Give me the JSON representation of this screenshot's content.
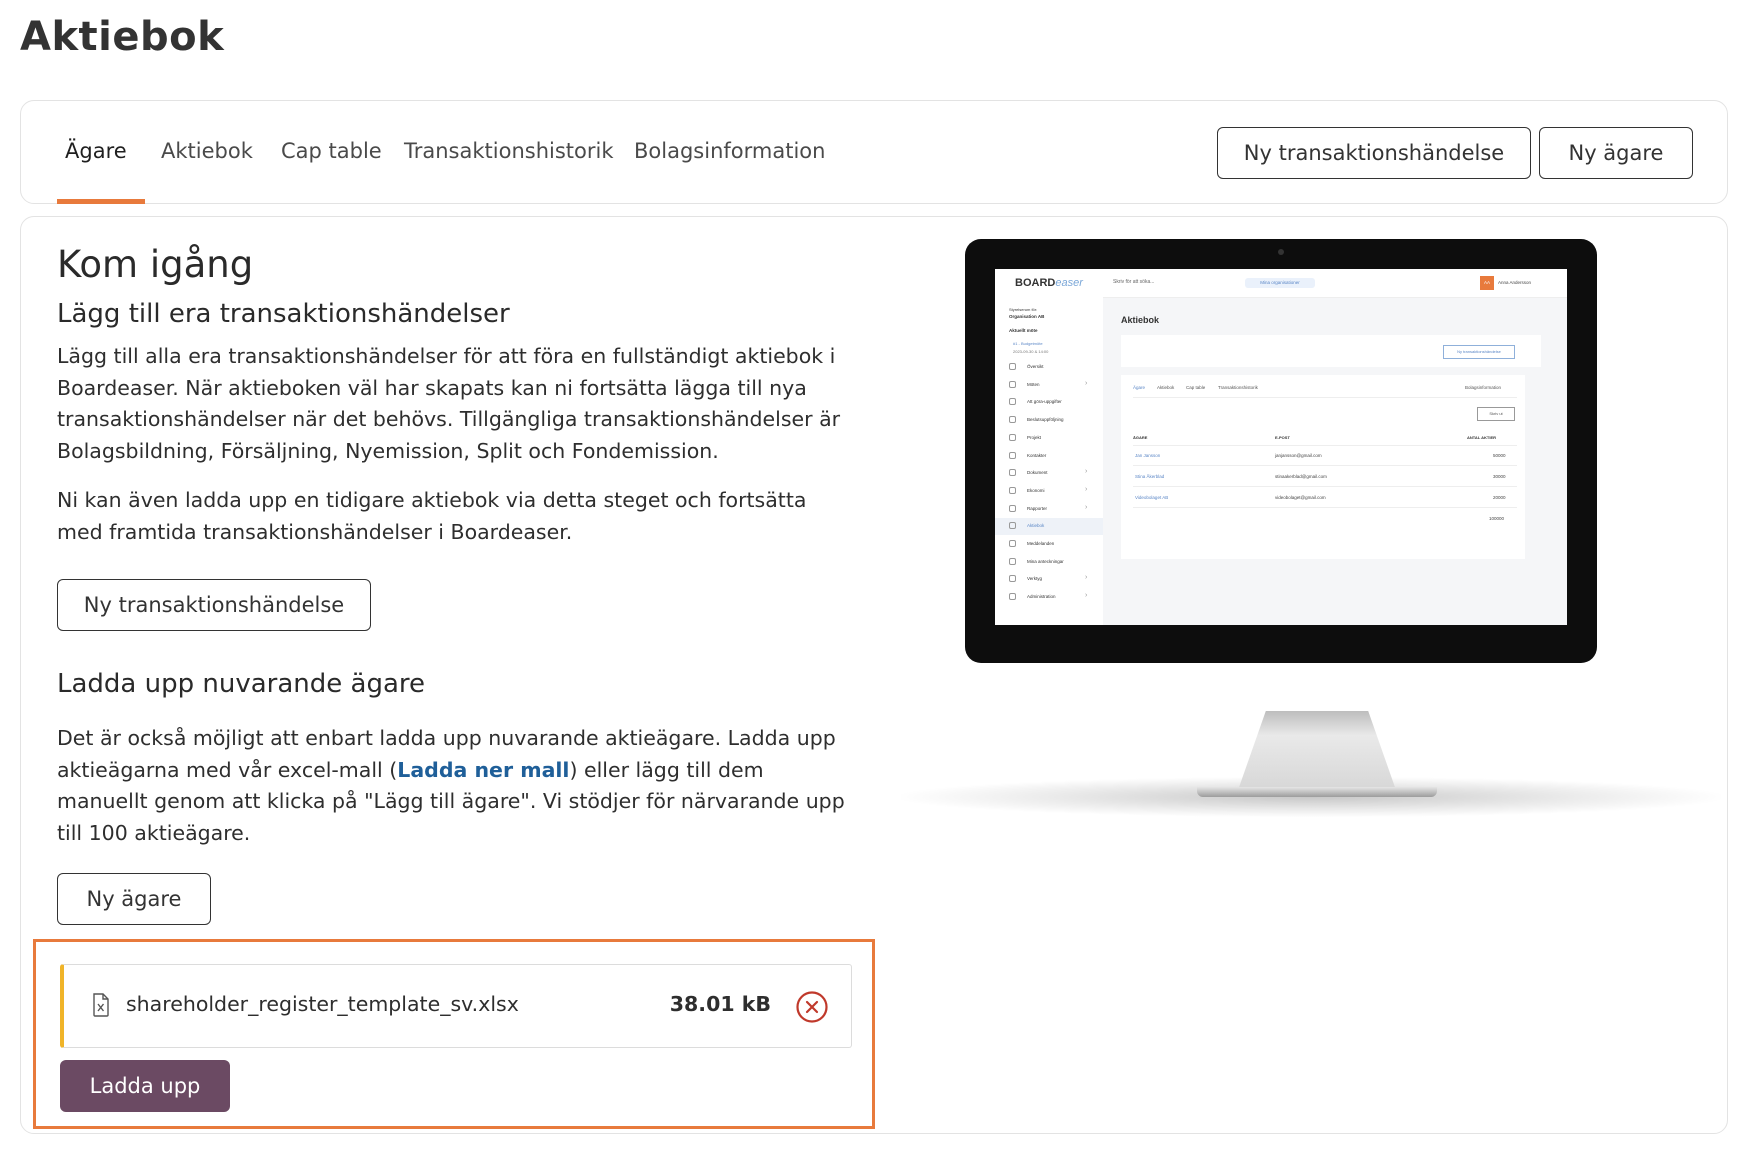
{
  "page": {
    "title": "Aktiebok"
  },
  "tabs": [
    {
      "label": "Ägare",
      "active": true
    },
    {
      "label": "Aktiebok",
      "active": false
    },
    {
      "label": "Cap table",
      "active": false
    },
    {
      "label": "Transaktionshistorik",
      "active": false
    },
    {
      "label": "Bolagsinformation",
      "active": false
    }
  ],
  "header_actions": {
    "new_transaction": "Ny transaktionshändelse",
    "new_owner": "Ny ägare"
  },
  "getting_started": {
    "title": "Kom igång",
    "transactions": {
      "heading": "Lägg till era transaktionshändelser",
      "para1": "Lägg till alla era transaktionshändelser för att föra en fullständigt aktiebok i Boardeaser. När aktieboken väl har skapats kan ni fortsätta lägga till nya transaktionshändelser när det behövs. Tillgängliga transaktionshändelser är Bolagsbildning, Försäljning, Nyemission, Split och Fondemission.",
      "para2": "Ni kan även ladda upp en tidigare aktiebok via detta steget och fortsätta med framtida transaktionshändelser i Boardeaser.",
      "button": "Ny transaktionshändelse"
    },
    "owners": {
      "heading": "Ladda upp nuvarande ägare",
      "text_before_link": "Det är också möjligt att enbart ladda upp nuvarande aktieägare. Ladda upp aktieägarna med vår excel-mall (",
      "link": "Ladda ner mall",
      "text_after_link": ") eller lägg till dem manuellt genom att klicka på \"Lägg till ägare\". Vi stödjer för närvarande upp till 100 aktieägare.",
      "button": "Ny ägare"
    },
    "upload": {
      "file_name": "shareholder_register_template_sv.xlsx",
      "file_size": "38.01 kB",
      "button": "Ladda upp"
    }
  },
  "illustration": {
    "logo_main": "BOARD",
    "logo_accent": "easer",
    "search_placeholder": "Skriv för att söka...",
    "org_pill": "Mina organisationer",
    "avatar": "AA",
    "user_name": "Anna Andersson",
    "board_label": "Styrelserum för:",
    "org_name": "Organisation AB",
    "current_meeting_label": "Aktuellt möte",
    "meeting_name": "#1 - Budgetmöte",
    "meeting_date": "2023-09-30 & 14:00",
    "nav": [
      {
        "label": "Översikt",
        "chevron": false
      },
      {
        "label": "Möten",
        "chevron": true
      },
      {
        "label": "Att göra-uppgifter",
        "chevron": false
      },
      {
        "label": "Beslutsuppföljning",
        "chevron": false
      },
      {
        "label": "Projekt",
        "chevron": false
      },
      {
        "label": "Kontakter",
        "chevron": false
      },
      {
        "label": "Dokument",
        "chevron": true
      },
      {
        "label": "Ekonomi",
        "chevron": true
      },
      {
        "label": "Rapporter",
        "chevron": true
      },
      {
        "label": "Aktiebok",
        "chevron": false,
        "active": true
      },
      {
        "label": "Meddelanden",
        "chevron": false
      },
      {
        "label": "Mina anteckningar",
        "chevron": false
      },
      {
        "label": "Verktyg",
        "chevron": true
      },
      {
        "label": "Administration",
        "chevron": true
      }
    ],
    "page_title": "Aktiebok",
    "new_transaction": "Ny transaktionshändelse",
    "tabs": [
      "Ägare",
      "Aktiebok",
      "Cap table",
      "Transaktionshistorik"
    ],
    "tab_right": "Bolagsinformation",
    "print_button": "Skriv ut",
    "columns": [
      "ÄGARE",
      "E-POST",
      "ANTAL AKTIER"
    ],
    "rows": [
      {
        "name": "Jan Jansson",
        "email": "janjansson@gmail.com",
        "shares": "50000"
      },
      {
        "name": "Stina Åkerblad",
        "email": "stinaakerblad@gmail.com",
        "shares": "30000"
      },
      {
        "name": "Videobolaget AB",
        "email": "videobolaget@gmail.com",
        "shares": "20000"
      }
    ],
    "total": "100000"
  },
  "colors": {
    "accent": "#e87a3c",
    "primary_button": "#6b4a63",
    "link": "#1f5f99",
    "file_marker": "#f0b429",
    "remove": "#c0392b"
  }
}
